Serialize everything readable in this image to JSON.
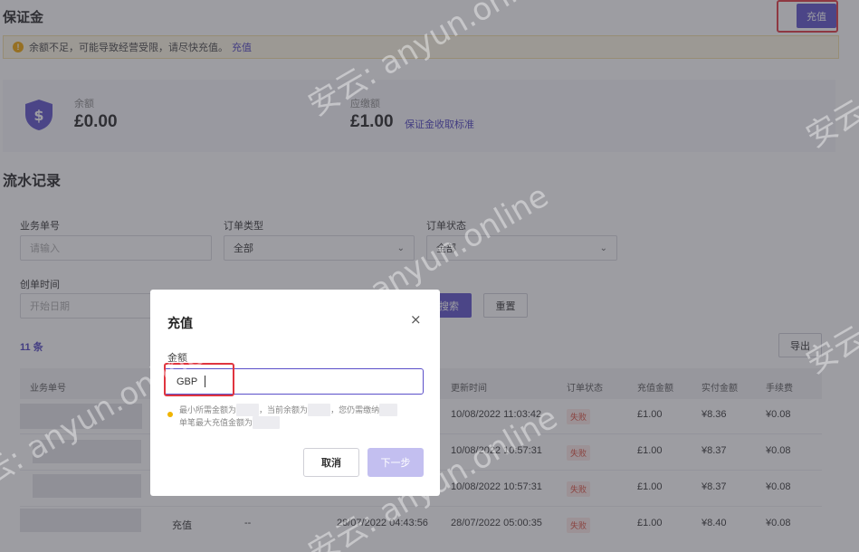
{
  "page": {
    "title": "保证金",
    "recharge_button": "充值"
  },
  "alert": {
    "message": "余额不足，可能导致经营受限，请尽快充值。",
    "link": "充值"
  },
  "balance": {
    "balance_label": "余额",
    "balance_value": "£0.00",
    "required_label": "应缴额",
    "required_value": "£1.00",
    "standard_link": "保证金收取标准"
  },
  "records": {
    "title": "流水记录",
    "filters": {
      "order_no_label": "业务单号",
      "order_no_placeholder": "请输入",
      "order_type_label": "订单类型",
      "order_type_value": "全部",
      "order_status_label": "订单状态",
      "order_status_value": "全部",
      "created_label": "创单时间",
      "start_date_placeholder": "开始日期",
      "search_button": "搜索",
      "reset_button": "重置",
      "export_button": "导出"
    },
    "count": "11 条",
    "columns": [
      "业务单号",
      "更新时间",
      "订单状态",
      "充值金额",
      "实付金额",
      "手续费"
    ],
    "rows": [
      {
        "type": "",
        "start": "",
        "update_time": "10/08/2022 11:03:42",
        "status": "失败",
        "amount": "£1.00",
        "paid": "¥8.36",
        "fee": "¥0.08"
      },
      {
        "type": "",
        "start": "",
        "update_time": "10/08/2022 10:57:31",
        "status": "失败",
        "amount": "£1.00",
        "paid": "¥8.37",
        "fee": "¥0.08"
      },
      {
        "type": "",
        "start": "",
        "update_time": "10/08/2022 10:57:31",
        "status": "失败",
        "amount": "£1.00",
        "paid": "¥8.37",
        "fee": "¥0.08"
      },
      {
        "type": "充值",
        "dash": "--",
        "start": "28/07/2022 04:43:56",
        "update_time": "28/07/2022 05:00:35",
        "status": "失败",
        "amount": "£1.00",
        "paid": "¥8.40",
        "fee": "¥0.08"
      }
    ]
  },
  "modal": {
    "title": "充值",
    "close": "×",
    "amount_label": "金额",
    "currency": "GBP",
    "hint_line1_a": "最小所需金额为",
    "hint_line1_b": "，当前余额为",
    "hint_line1_c": "，您仍需缴纳",
    "hint_line2": "单笔最大充值金额为",
    "cancel": "取消",
    "next": "下一步"
  },
  "watermark": "安云: anyun.online",
  "colors": {
    "accent": "#5b4fc9",
    "highlight": "#e0353f",
    "warning": "#f0a500",
    "fail": "#d94a3a"
  }
}
